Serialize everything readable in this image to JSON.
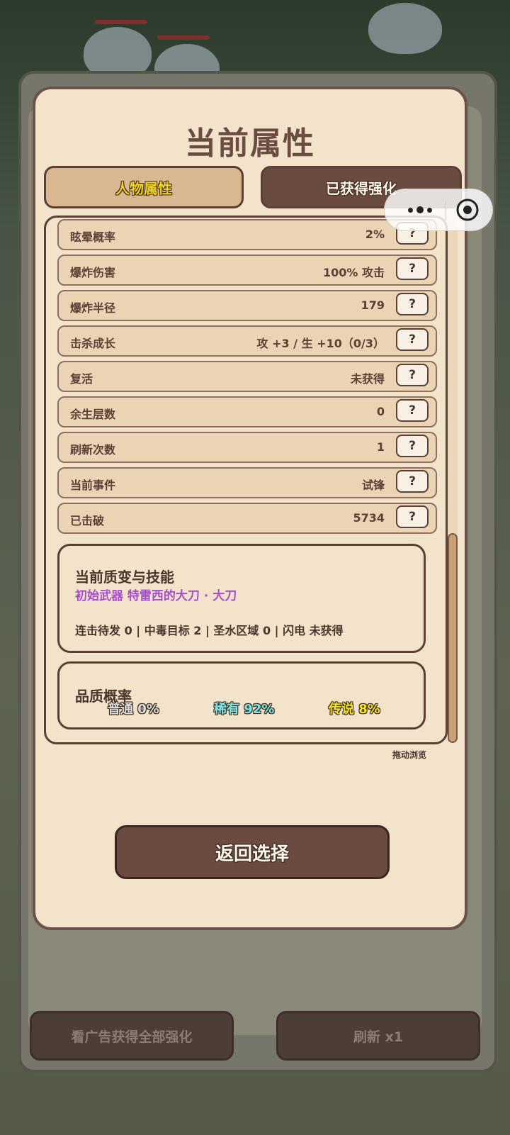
{
  "modal": {
    "title": "当前属性",
    "tabs": [
      {
        "label": "人物属性",
        "active": true
      },
      {
        "label": "已获得强化",
        "active": false
      }
    ],
    "stats": [
      {
        "label": "眩晕概率",
        "value": "2%",
        "help": "?"
      },
      {
        "label": "爆炸伤害",
        "value": "100% 攻击",
        "help": "?"
      },
      {
        "label": "爆炸半径",
        "value": "179",
        "help": "?"
      },
      {
        "label": "击杀成长",
        "value": "攻 +3 / 生 +10（0/3）",
        "help": "?"
      },
      {
        "label": "复活",
        "value": "未获得",
        "help": "?"
      },
      {
        "label": "余生层数",
        "value": "0",
        "help": "?"
      },
      {
        "label": "刷新次数",
        "value": "1",
        "help": "?"
      },
      {
        "label": "当前事件",
        "value": "试锋",
        "help": "?"
      },
      {
        "label": "已击破",
        "value": "5734",
        "help": "?"
      }
    ],
    "skills": {
      "title": "当前质变与技能",
      "weapon": "初始武器 特雷西的大刀 · 大刀",
      "status_line": "连击待发 0 | 中毒目标 2 | 圣水区域 0 | 闪电 未获得"
    },
    "quality": {
      "title": "品质概率",
      "common": "普通 0%",
      "rare": "稀有 92%",
      "legendary": "传说 8%"
    },
    "drag_hint": "拖动浏览",
    "return_button": "返回选择"
  },
  "bottom_bar": {
    "ad_button": "看广告获得全部强化",
    "refresh_button": "刷新 x1"
  },
  "colors": {
    "panel_bg": "#f3e3ca",
    "border": "#5a3f35",
    "weapon_text": "#a64fc9",
    "common": "#dcdcdc",
    "rare": "#7fe7e7",
    "legendary": "#f4e52c",
    "active_tab_text": "#f1d326"
  },
  "icons": [
    "more-dots-icon",
    "close-target-icon",
    "question-icon"
  ]
}
